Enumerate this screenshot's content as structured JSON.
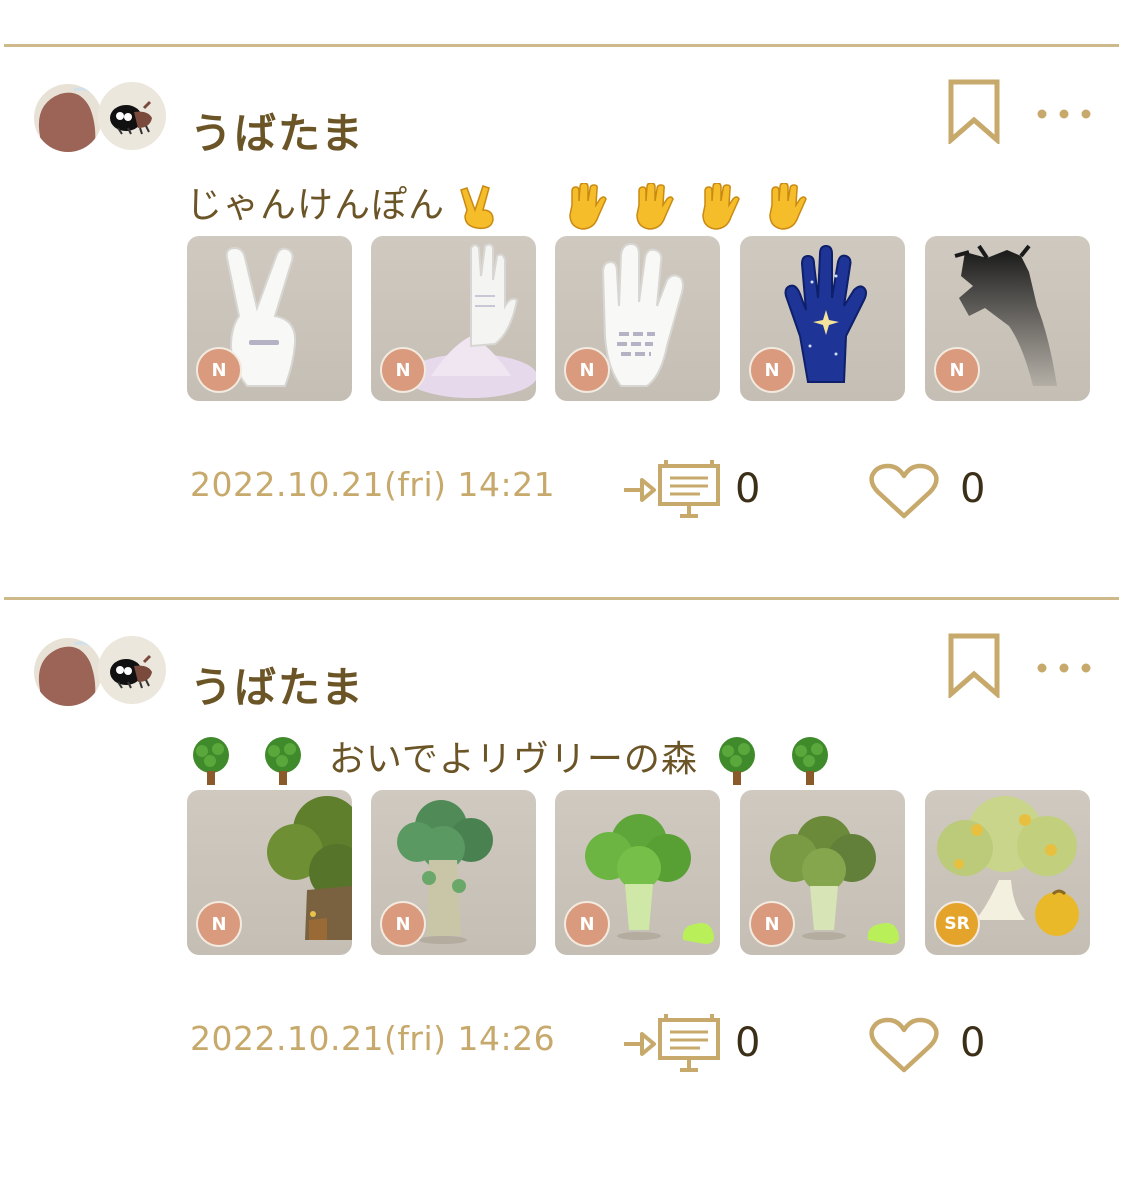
{
  "posts": [
    {
      "username": "うばたま",
      "caption_text": "じゃんけんぽん",
      "caption_emojis_after": [
        "victory-hand",
        "raised-hand",
        "raised-hand",
        "raised-hand",
        "raised-hand"
      ],
      "cards": [
        {
          "item": "peace-sign-hand",
          "rarity": "N"
        },
        {
          "item": "white-hand-pedestal",
          "rarity": "N"
        },
        {
          "item": "white-open-palm",
          "rarity": "N"
        },
        {
          "item": "starry-blue-hand",
          "rarity": "N"
        },
        {
          "item": "shadow-claw-hand",
          "rarity": "N"
        }
      ],
      "timestamp": "2022.10.21(fri) 14:21",
      "share_count": "0",
      "like_count": "0"
    },
    {
      "username": "うばたま",
      "caption_text": "おいでよリヴリーの森",
      "caption_emojis_before": [
        "tree",
        "tree"
      ],
      "caption_emojis_after": [
        "tree",
        "tree"
      ],
      "cards": [
        {
          "item": "big-oak-tree",
          "rarity": "N"
        },
        {
          "item": "tall-green-tree",
          "rarity": "N"
        },
        {
          "item": "broccoli-tree",
          "rarity": "N"
        },
        {
          "item": "moss-broccoli-tree",
          "rarity": "N"
        },
        {
          "item": "golden-fruit-tree",
          "rarity": "SR"
        }
      ],
      "timestamp": "2022.10.21(fri) 14:26",
      "share_count": "0",
      "like_count": "0"
    }
  ],
  "colors": {
    "accent": "#6b5527",
    "divider": "#cdb98a",
    "timestamp": "#c7a96c",
    "rarity_n": "#d99a7d",
    "rarity_sr": "#e4a42b"
  }
}
